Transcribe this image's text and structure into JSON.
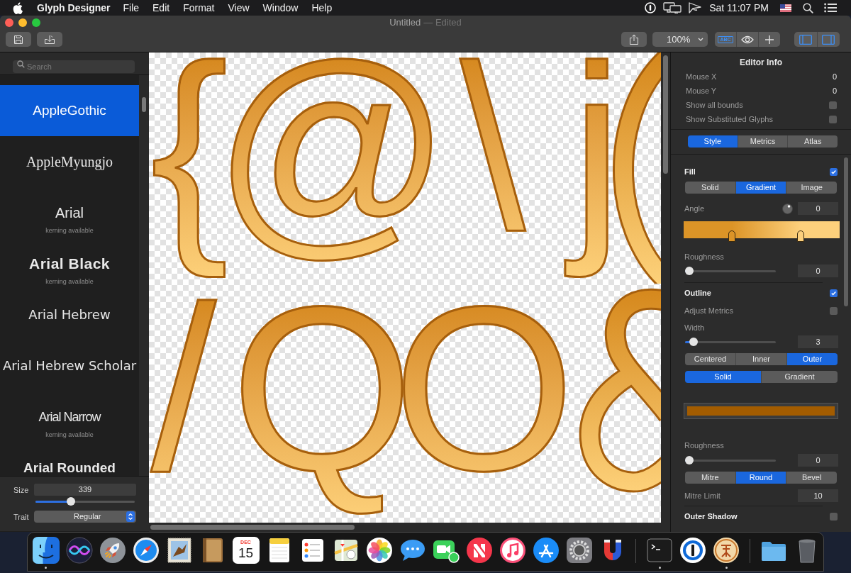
{
  "menu_bar": {
    "app_name": "Glyph Designer",
    "menus": [
      "File",
      "Edit",
      "Format",
      "View",
      "Window",
      "Help"
    ],
    "clock": "Sat 11:07 PM"
  },
  "window": {
    "title": "Untitled",
    "status": "— Edited"
  },
  "toolbar": {
    "zoom": "100%",
    "view_toggles": [
      {
        "label": "ABC",
        "on": true
      },
      {
        "on": false
      },
      {
        "on": false
      }
    ],
    "panel_toggles": [
      {
        "on": true
      },
      {
        "on": true
      }
    ]
  },
  "sidebar": {
    "search": {
      "placeholder": "Search"
    },
    "fonts": [
      {
        "name": "AppleGothic",
        "selected": true
      },
      {
        "name": "AppleMyungjo",
        "selected": false
      },
      {
        "name": "Arial",
        "note": "kerning available",
        "selected": false
      },
      {
        "name": "Arial Black",
        "note": "kerning available",
        "selected": false
      },
      {
        "name": "Arial Hebrew",
        "selected": false
      },
      {
        "name": "Arial Hebrew Scholar",
        "selected": false
      },
      {
        "name": "Arial Narrow",
        "note": "kerning available",
        "selected": false
      },
      {
        "name": "Arial Rounded",
        "selected": false
      }
    ],
    "size": {
      "label": "Size",
      "value": "339",
      "level": 0.34
    },
    "trait": {
      "label": "Trait",
      "value": "Regular"
    }
  },
  "canvas": {
    "glyph_rows": [
      [
        "{",
        "@",
        "\\",
        "j"
      ],
      [
        "/",
        "Q",
        "O"
      ]
    ]
  },
  "inspector": {
    "title": "Editor Info",
    "info": [
      {
        "kind": "value",
        "label": "Mouse X",
        "value": "0"
      },
      {
        "kind": "value",
        "label": "Mouse Y",
        "value": "0"
      },
      {
        "kind": "checkbox",
        "label": "Show all bounds",
        "checked": false
      },
      {
        "kind": "checkbox",
        "label": "Show Substituted Glyphs",
        "checked": false
      }
    ],
    "tabs": [
      {
        "label": "Style",
        "selected": true
      },
      {
        "label": "Metrics",
        "selected": false
      },
      {
        "label": "Atlas",
        "selected": false
      }
    ],
    "fill": {
      "title": "Fill",
      "checked": true,
      "modes": [
        {
          "label": "Solid",
          "selected": false
        },
        {
          "label": "Gradient",
          "selected": true
        },
        {
          "label": "Image",
          "selected": false
        }
      ],
      "angle": {
        "label": "Angle",
        "value": "0"
      },
      "gradient_stops": [
        {
          "color": "#dc9427",
          "level": 0.31
        },
        {
          "color": "#fdd07c",
          "level": 0.75
        }
      ],
      "roughness": {
        "label": "Roughness",
        "value": "0",
        "level": 0
      }
    },
    "outline": {
      "title": "Outline",
      "checked": true,
      "adjust_metrics": {
        "label": "Adjust Metrics",
        "checked": false
      },
      "width": {
        "label": "Width",
        "value": "3",
        "level": 0.05
      },
      "position": [
        {
          "label": "Centered",
          "selected": false
        },
        {
          "label": "Inner",
          "selected": false
        },
        {
          "label": "Outer",
          "selected": true
        }
      ],
      "paint": [
        {
          "label": "Solid",
          "selected": true
        },
        {
          "label": "Gradient",
          "selected": false
        }
      ],
      "color": "#a35c00",
      "roughness": {
        "label": "Roughness",
        "value": "0",
        "level": 0
      },
      "join": [
        {
          "label": "Mitre",
          "selected": false
        },
        {
          "label": "Round",
          "selected": true
        },
        {
          "label": "Bevel",
          "selected": false
        }
      ],
      "mitre_limit": {
        "label": "Mitre Limit",
        "value": "10"
      }
    },
    "outer_shadow": {
      "title": "Outer Shadow",
      "checked": false
    }
  },
  "dock": {
    "items": [
      {
        "running": true
      },
      {
        "running": false
      },
      {
        "running": false
      },
      {
        "running": false
      },
      {
        "running": false
      },
      {
        "running": false
      },
      {
        "running": false,
        "month": "DEC",
        "day": "15"
      },
      {
        "running": false
      },
      {
        "running": false
      },
      {
        "running": false
      },
      {
        "running": false
      },
      {
        "running": false
      },
      {
        "running": false
      },
      {
        "running": false
      },
      {
        "running": false
      },
      {
        "running": false
      },
      {
        "running": false
      },
      {
        "running": false
      },
      {
        "running": true
      },
      {
        "running": false
      },
      {
        "running": true
      },
      {
        "running": false
      },
      {
        "running": false
      }
    ]
  }
}
